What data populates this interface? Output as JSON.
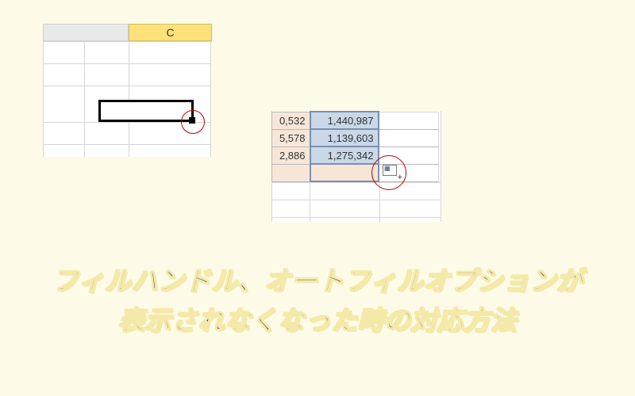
{
  "left_snippet": {
    "column_header": "C"
  },
  "right_snippet": {
    "rows": [
      {
        "partial": "0,532",
        "value": "1,440,987"
      },
      {
        "partial": "5,578",
        "value": "1,139,603"
      },
      {
        "partial": "2,886",
        "value": "1,275,342"
      }
    ],
    "autofill_button_glyph": "▦"
  },
  "headline": {
    "line1": "フィルハンドル、オートフィルオプションが",
    "line2": "表示されなくなった時の対応方法"
  }
}
